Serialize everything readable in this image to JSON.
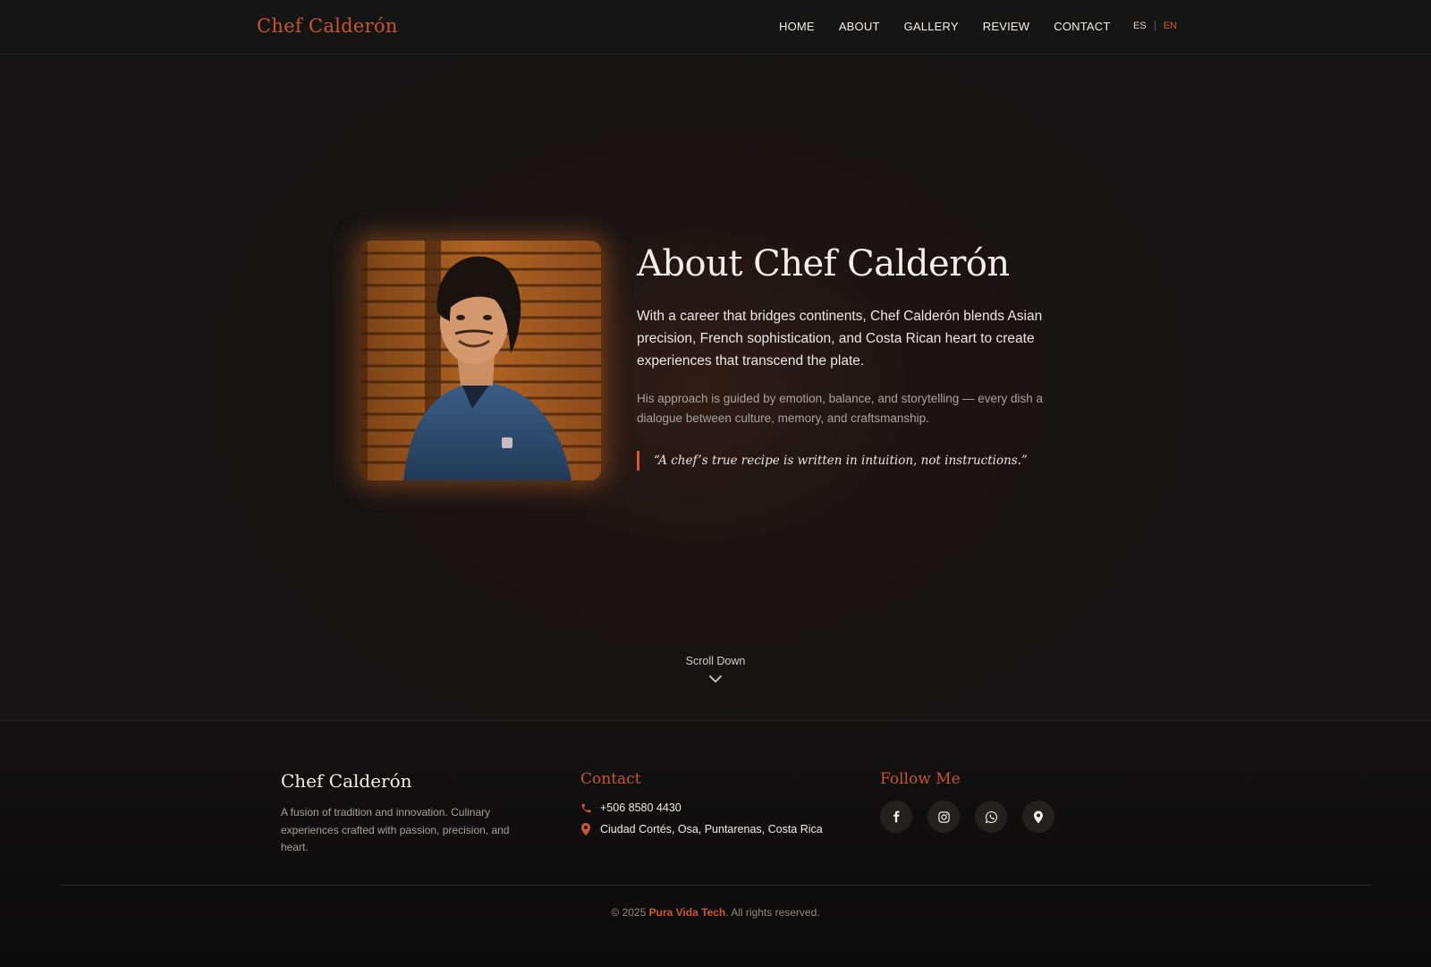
{
  "header": {
    "brand": "Chef Calderón",
    "nav": [
      "HOME",
      "ABOUT",
      "GALLERY",
      "REVIEW",
      "CONTACT"
    ],
    "lang": {
      "es": "ES",
      "en": "EN",
      "active": "EN"
    }
  },
  "hero": {
    "title": "About Chef Calderón",
    "lead": "With a career that bridges continents, Chef Calderón blends Asian precision, French sophistication, and Costa Rican heart to create experiences that transcend the plate.",
    "sub": "His approach is guided by emotion, balance, and storytelling — every dish a dialogue between culture, memory, and craftsmanship.",
    "quote": "“A chef’s true recipe is written in intuition, not instructions.”",
    "scroll_label": "Scroll Down"
  },
  "footer": {
    "brand": "Chef Calderón",
    "description": "A fusion of tradition and innovation. Culinary experiences crafted with passion, precision, and heart.",
    "contact_title": "Contact",
    "phone": "+506 8580 4430",
    "address": "Ciudad Cortés, Osa, Puntarenas, Costa Rica",
    "follow_title": "Follow Me",
    "socials": [
      "facebook-icon",
      "instagram-icon",
      "whatsapp-icon",
      "map-pin-icon"
    ],
    "copyright_prefix": "© 2025 ",
    "copyright_company": "Pura Vida Tech",
    "copyright_suffix": ". All rights reserved."
  },
  "colors": {
    "accent": "#d0582f",
    "background": "#141212",
    "text": "#f3efe9"
  }
}
